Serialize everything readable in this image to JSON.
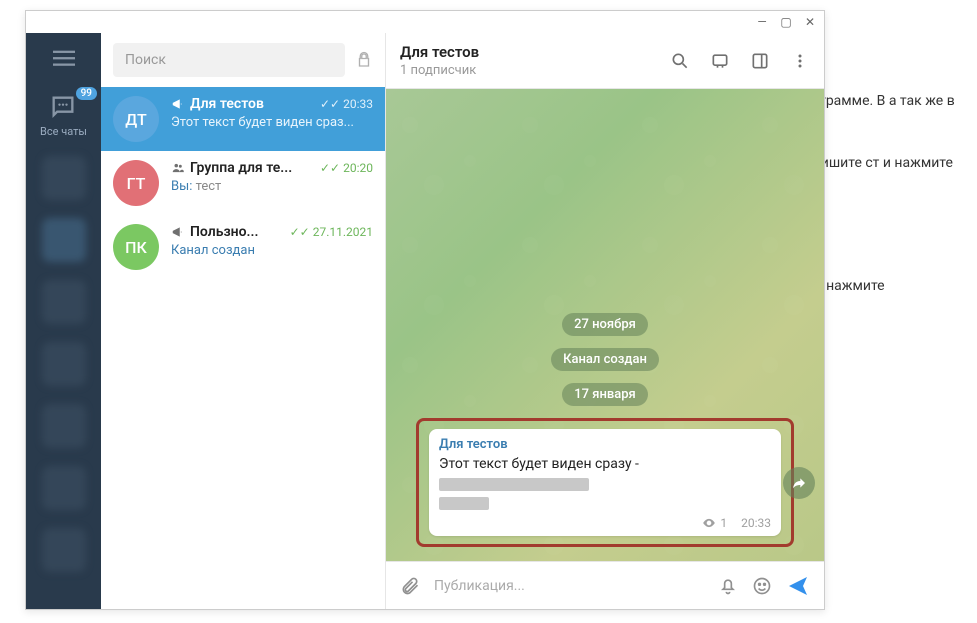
{
  "bg_text": {
    "p1": "елеграмме. В а так же в",
    "p2": "напишите ст и нажмите",
    "p3": "ст и нажмите"
  },
  "sidebar": {
    "all_chats_label": "Все чаты",
    "badge": "99"
  },
  "search": {
    "placeholder": "Поиск"
  },
  "chats": [
    {
      "avatar": "ДТ",
      "name": "Для тестов",
      "time": "20:33",
      "preview": "Этот текст будет виден сраз..."
    },
    {
      "avatar": "ГТ",
      "name": "Группа для те...",
      "time": "20:20",
      "you": "Вы: ",
      "preview": "тест"
    },
    {
      "avatar": "ПК",
      "name": "Пользно...",
      "time": "27.11.2021",
      "preview": "Канал создан"
    }
  ],
  "header": {
    "title": "Для тестов",
    "subtitle": "1 подписчик"
  },
  "timeline": {
    "date1": "27 ноября",
    "service1": "Канал создан",
    "date2": "17 января"
  },
  "message": {
    "from": "Для тестов",
    "text": "Этот текст будет виден сразу - ",
    "views": "1",
    "time": "20:33"
  },
  "composer": {
    "placeholder": "Публикация..."
  }
}
